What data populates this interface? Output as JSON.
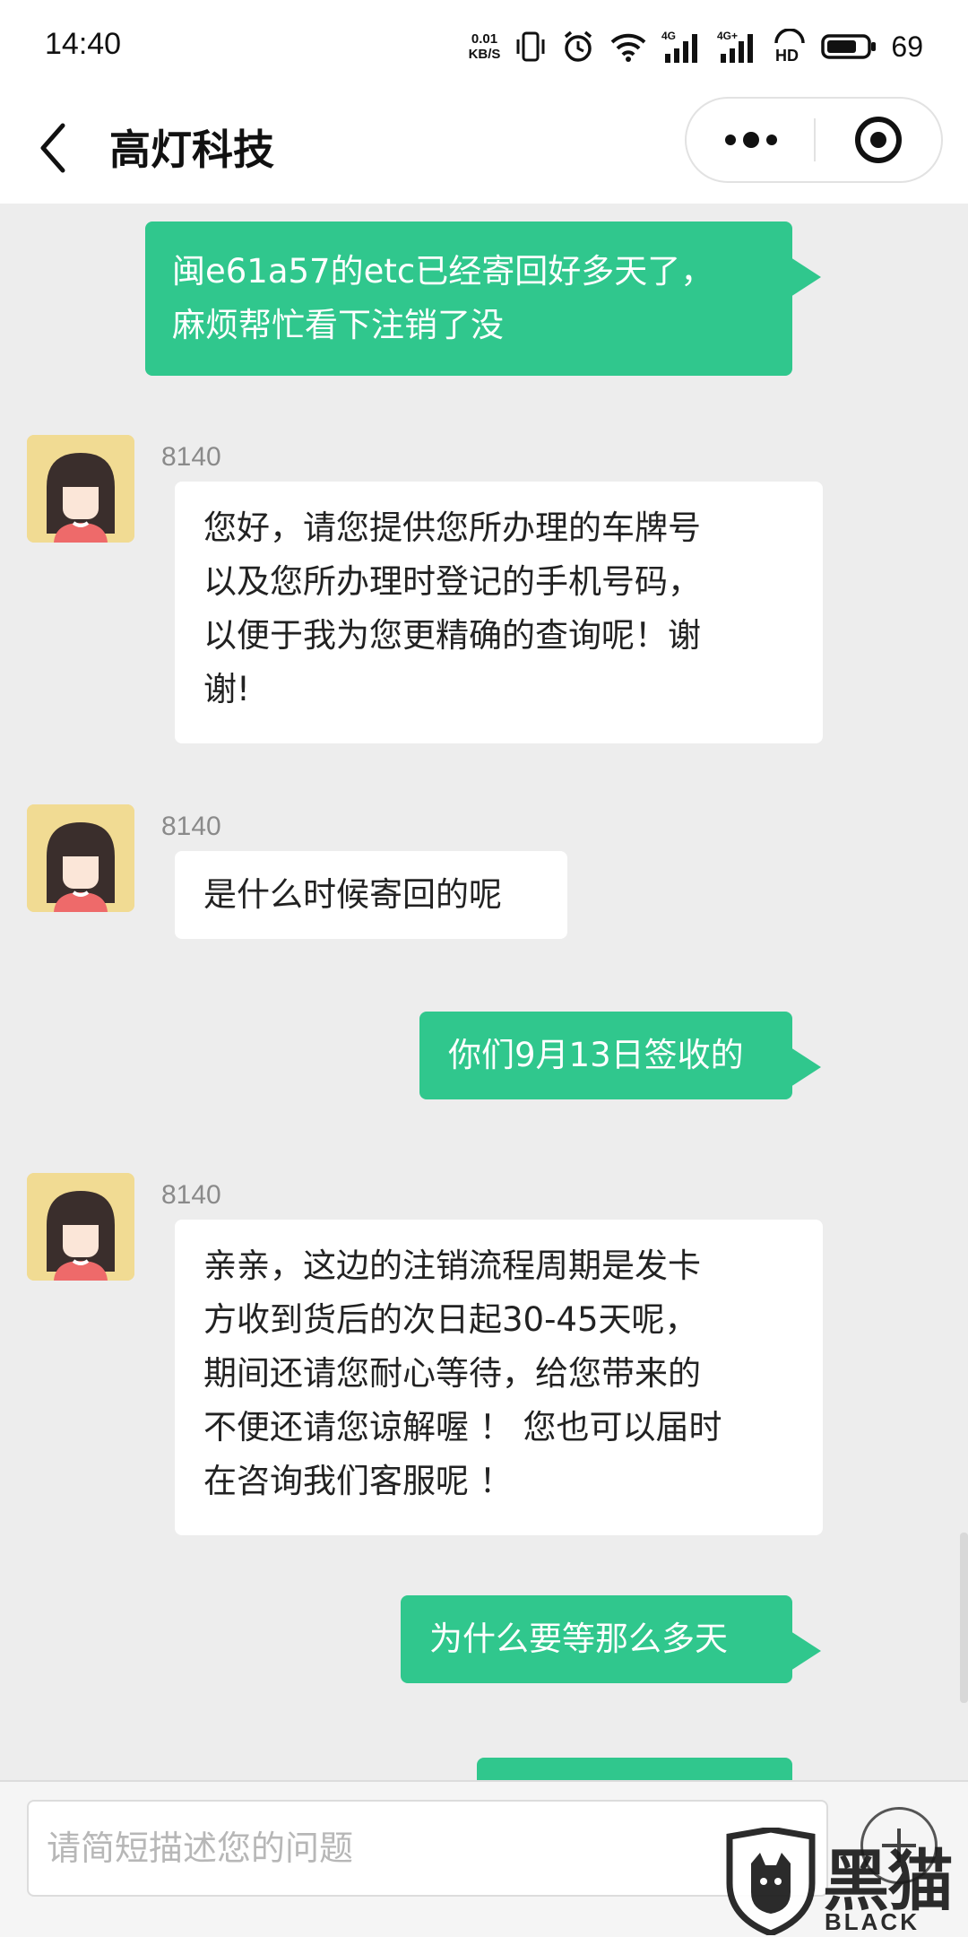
{
  "status_bar": {
    "time": "14:40",
    "net_speed_value": "0.01",
    "net_speed_unit": "KB/S",
    "signal1_label": "4G",
    "signal2_label": "4G+",
    "hd_label": "HD",
    "battery": "69"
  },
  "header": {
    "title": "高灯科技",
    "icons": {
      "back": "chevron-left-icon",
      "more": "more-dots-icon",
      "close": "target-close-icon"
    }
  },
  "messages": [
    {
      "from": "me",
      "lines": [
        "闽e61a57的etc已经寄回好多天了，",
        "麻烦帮忙看下注销了没"
      ]
    },
    {
      "from": "agent",
      "name": "8140",
      "lines": [
        "您好，请您提供您所办理的车牌号",
        "以及您所办理时登记的手机号码，",
        "以便于我为您更精确的查询呢！谢",
        "谢!"
      ]
    },
    {
      "from": "agent",
      "name": "8140",
      "lines": [
        "是什么时候寄回的呢"
      ]
    },
    {
      "from": "me",
      "lines": [
        "你们9月13日签收的"
      ]
    },
    {
      "from": "agent",
      "name": "8140",
      "lines": [
        "亲亲，这边的注销流程周期是发卡",
        "方收到货后的次日起30-45天呢，",
        "期间还请您耐心等待，给您带来的",
        "不便还请您谅解喔 ！ 您也可以届时",
        "在咨询我们客服呢 ！"
      ]
    },
    {
      "from": "me",
      "lines": [
        "为什么要等那么多天"
      ]
    }
  ],
  "input": {
    "placeholder": "请简短描述您的问题"
  },
  "watermark": {
    "zh": "黑猫",
    "en": "BLACK CAT"
  },
  "colors": {
    "accent": "#30c78d",
    "background": "#ededed",
    "avatar_bg": "#f1db93"
  }
}
